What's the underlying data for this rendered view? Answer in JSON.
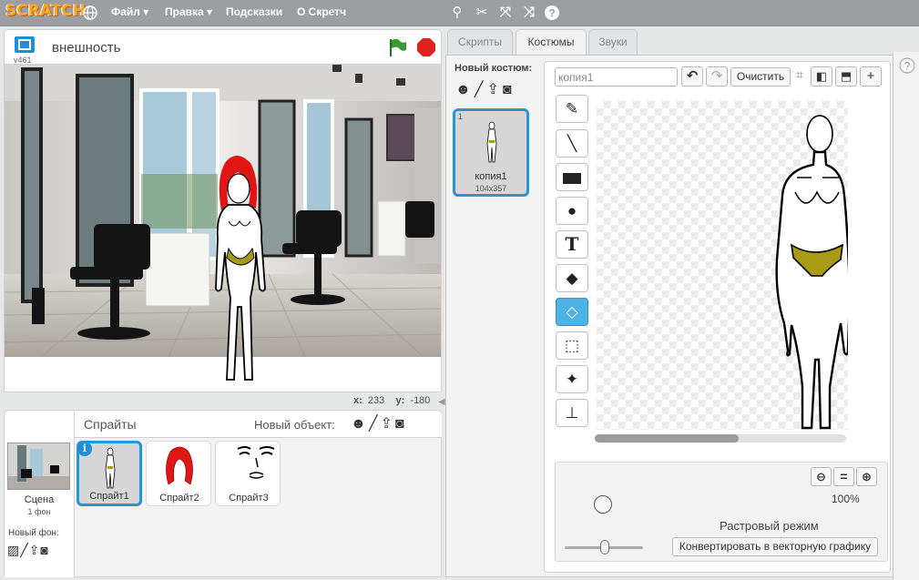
{
  "app": {
    "logo": "SCRATCH",
    "menu": {
      "file": "Файл ▾",
      "edit": "Правка ▾",
      "tips": "Подсказки",
      "about": "О Скретч"
    }
  },
  "stage": {
    "project_title": "внешность",
    "version": "v461",
    "coords": {
      "x_label": "x:",
      "x_value": "233",
      "y_label": "y:",
      "y_value": "-180"
    }
  },
  "sprites_panel": {
    "title": "Спрайты",
    "new_object_label": "Новый объект:",
    "scene": {
      "label": "Сцена",
      "backdrops": "1 фон",
      "new_backdrop_label": "Новый фон:"
    },
    "sprites": [
      {
        "name": "Спрайт1",
        "selected": true
      },
      {
        "name": "Спрайт2",
        "selected": false
      },
      {
        "name": "Спрайт3",
        "selected": false
      }
    ]
  },
  "tabs": [
    {
      "label": "Скрипты",
      "active": false
    },
    {
      "label": "Костюмы",
      "active": true
    },
    {
      "label": "Звуки",
      "active": false
    }
  ],
  "costumes": {
    "new_costume_label": "Новый костюм:",
    "items": [
      {
        "index": "1",
        "name": "копия1",
        "size": "104x357",
        "selected": true
      }
    ]
  },
  "editor": {
    "costume_name_value": "копия1",
    "clear_label": "Очистить",
    "zoom_level": "100%",
    "mode_label": "Растровый режим",
    "convert_label": "Конвертировать в векторную графику",
    "tools": [
      "brush",
      "line",
      "rectangle",
      "ellipse",
      "text",
      "fill",
      "eraser",
      "select",
      "select-remove-background",
      "stamp"
    ],
    "selected_tool": "eraser"
  },
  "colors": {
    "accent": "#2596d8",
    "menu_bar": "#9c9ea2",
    "tool_selected": "#4eb2e4",
    "hair": "#e01515",
    "bikini": "#a79b14",
    "green_flag": "#3a9a33",
    "stop": "#e0201e"
  }
}
